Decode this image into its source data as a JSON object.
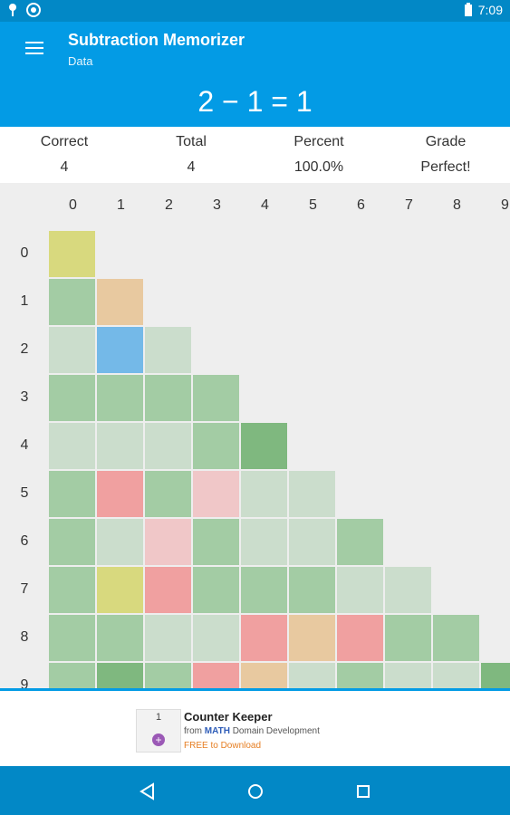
{
  "status": {
    "time": "7:09"
  },
  "app": {
    "title": "Subtraction Memorizer",
    "subtitle": "Data"
  },
  "equation": "2 − 1 = 1",
  "stats": [
    {
      "label": "Correct",
      "value": "4"
    },
    {
      "label": "Total",
      "value": "4"
    },
    {
      "label": "Percent",
      "value": "100.0%"
    },
    {
      "label": "Grade",
      "value": "Perfect!"
    }
  ],
  "grid": {
    "columns": [
      "0",
      "1",
      "2",
      "3",
      "4",
      "5",
      "6",
      "7",
      "8",
      "9"
    ],
    "rows": [
      "0",
      "1",
      "2",
      "3",
      "4",
      "5",
      "6",
      "7",
      "8",
      "9"
    ],
    "colors": {
      "Y": "#d8d97e",
      "O": "#e8c9a0",
      "B": "#74b9e8",
      "L": "#cbddcc",
      "M": "#a3cca4",
      "D": "#7fb87f",
      "R": "#f0a0a0",
      "P": "#f0c7c8"
    },
    "cells": [
      [
        "Y"
      ],
      [
        "M",
        "O"
      ],
      [
        "L",
        "B",
        "L"
      ],
      [
        "M",
        "M",
        "M",
        "M"
      ],
      [
        "L",
        "L",
        "L",
        "M",
        "D"
      ],
      [
        "M",
        "R",
        "M",
        "P",
        "L",
        "L"
      ],
      [
        "M",
        "L",
        "P",
        "M",
        "L",
        "L",
        "M"
      ],
      [
        "M",
        "Y",
        "R",
        "M",
        "M",
        "M",
        "L",
        "L"
      ],
      [
        "M",
        "M",
        "L",
        "L",
        "R",
        "O",
        "R",
        "M",
        "M"
      ],
      [
        "M",
        "D",
        "M",
        "R",
        "O",
        "L",
        "M",
        "L",
        "L",
        "D"
      ]
    ]
  },
  "ad": {
    "icon_value": "1",
    "title": "Counter Keeper",
    "from_prefix": "from ",
    "from_brand": "MATH",
    "from_suffix": " Domain Development",
    "cta": "FREE to Download"
  }
}
